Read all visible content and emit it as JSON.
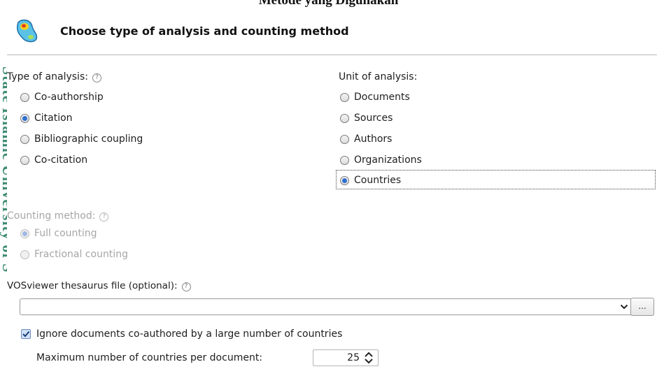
{
  "document": {
    "caption": "Metode yang Digunakan",
    "side_text": "State Islamic University of S"
  },
  "dialog": {
    "title": "Choose type of analysis and counting method",
    "type_of_analysis": {
      "label": "Type of analysis:",
      "options": [
        {
          "label": "Co-authorship",
          "selected": false
        },
        {
          "label": "Citation",
          "selected": true
        },
        {
          "label": "Bibliographic coupling",
          "selected": false
        },
        {
          "label": "Co-citation",
          "selected": false
        }
      ]
    },
    "unit_of_analysis": {
      "label": "Unit of analysis:",
      "options": [
        {
          "label": "Documents",
          "selected": false
        },
        {
          "label": "Sources",
          "selected": false
        },
        {
          "label": "Authors",
          "selected": false
        },
        {
          "label": "Organizations",
          "selected": false
        },
        {
          "label": "Countries",
          "selected": true
        }
      ]
    },
    "counting_method": {
      "label": "Counting method:",
      "enabled": false,
      "options": [
        {
          "label": "Full counting",
          "selected": true
        },
        {
          "label": "Fractional counting",
          "selected": false
        }
      ]
    },
    "thesaurus": {
      "label": "VOSviewer thesaurus file (optional):",
      "value": "",
      "browse_label": "..."
    },
    "ignore_large": {
      "label": "Ignore documents co-authored by a large number of countries",
      "checked": true
    },
    "max_countries": {
      "label": "Maximum number of countries per document:",
      "value": "25"
    }
  },
  "icons": {
    "app": "vosviewer-logo-icon",
    "help": "question-mark-icon",
    "dropdown": "chevron-down-icon",
    "spinner": "spin-arrows-icon",
    "check": "checkmark-icon"
  },
  "colors": {
    "accent": "#2f6fd0",
    "watermark": "#3e8a73"
  }
}
